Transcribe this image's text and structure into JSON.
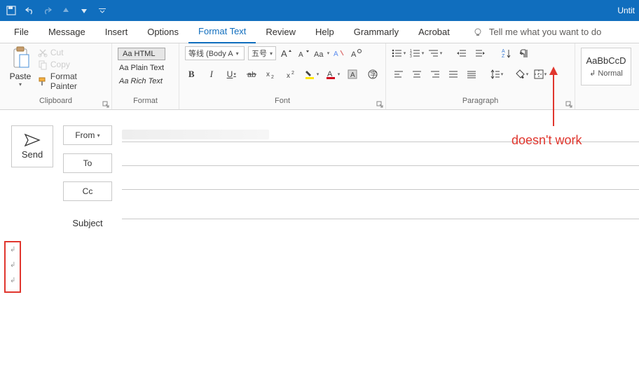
{
  "titlebar": {
    "title": "Untit"
  },
  "quick_access": [
    "save",
    "undo",
    "redo",
    "up",
    "down",
    "more"
  ],
  "tabs": {
    "items": [
      "File",
      "Message",
      "Insert",
      "Options",
      "Format Text",
      "Review",
      "Help",
      "Grammarly",
      "Acrobat"
    ],
    "active_index": 4,
    "tell_me": "Tell me what you want to do"
  },
  "ribbon": {
    "clipboard": {
      "label": "Clipboard",
      "paste": "Paste",
      "cut": "Cut",
      "copy": "Copy",
      "format_painter": "Format Painter"
    },
    "format": {
      "label": "Format",
      "html": "Aa HTML",
      "plain": "Aa Plain Text",
      "rich": "Aa Rich Text"
    },
    "font": {
      "label": "Font",
      "font_name": "等线 (Body A",
      "font_size": "五号",
      "bold": "B",
      "italic": "I",
      "underline": "U"
    },
    "paragraph": {
      "label": "Paragraph"
    },
    "styles": {
      "sample_top": "AaBbCcD",
      "sample_bot": "↲ Normal"
    }
  },
  "compose": {
    "send": "Send",
    "from": "From",
    "to": "To",
    "cc": "Cc",
    "subject": "Subject"
  },
  "body_marks": [
    "↲",
    "↲",
    "↲"
  ],
  "annotation": "doesn't work"
}
